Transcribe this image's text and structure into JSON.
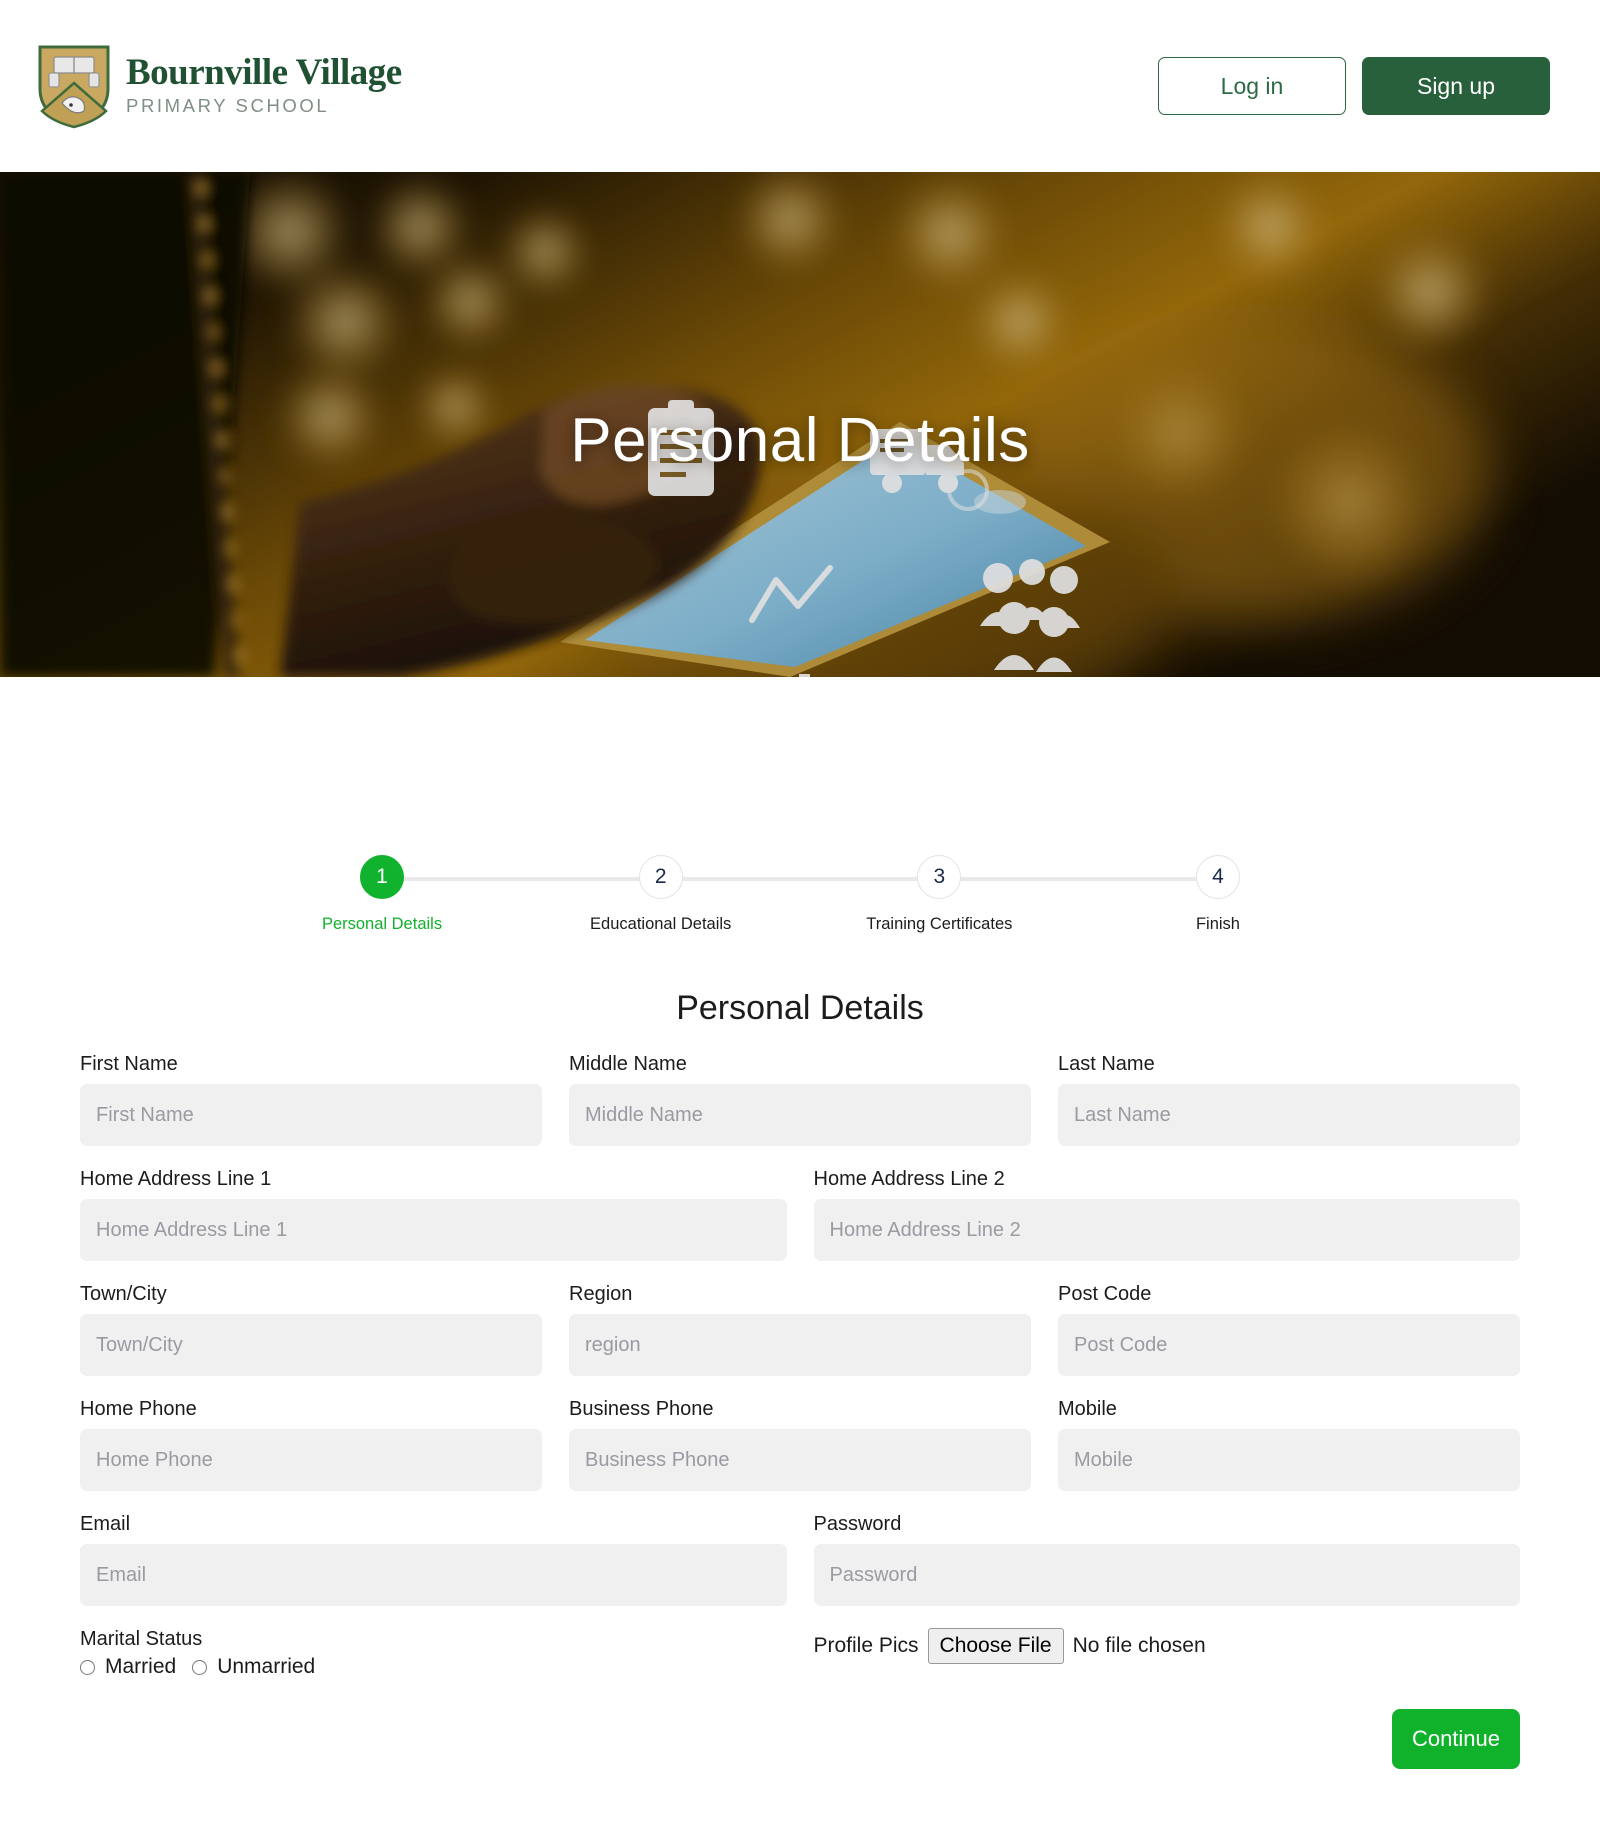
{
  "header": {
    "logo": {
      "name": "Bournville Village",
      "subtitle": "PRIMARY SCHOOL",
      "crest_icon": "school-crest-icon"
    },
    "login_label": "Log in",
    "signup_label": "Sign up"
  },
  "hero": {
    "title": "Personal Details"
  },
  "stepper": {
    "steps": [
      {
        "number": "1",
        "label": "Personal Details",
        "active": true
      },
      {
        "number": "2",
        "label": "Educational Details",
        "active": false
      },
      {
        "number": "3",
        "label": "Training Certificates",
        "active": false
      },
      {
        "number": "4",
        "label": "Finish",
        "active": false
      }
    ]
  },
  "form": {
    "heading": "Personal Details",
    "first_name": {
      "label": "First Name",
      "placeholder": "First Name",
      "value": ""
    },
    "middle_name": {
      "label": "Middle Name",
      "placeholder": "Middle Name",
      "value": ""
    },
    "last_name": {
      "label": "Last Name",
      "placeholder": "Last Name",
      "value": ""
    },
    "address1": {
      "label": "Home Address Line 1",
      "placeholder": "Home Address Line 1",
      "value": ""
    },
    "address2": {
      "label": "Home Address Line 2",
      "placeholder": "Home Address Line 2",
      "value": ""
    },
    "town_city": {
      "label": "Town/City",
      "placeholder": "Town/City",
      "value": ""
    },
    "region": {
      "label": "Region",
      "placeholder": "region",
      "value": ""
    },
    "post_code": {
      "label": "Post Code",
      "placeholder": "Post Code",
      "value": ""
    },
    "home_phone": {
      "label": "Home Phone",
      "placeholder": "Home Phone",
      "value": ""
    },
    "business_phone": {
      "label": "Business Phone",
      "placeholder": "Business Phone",
      "value": ""
    },
    "mobile": {
      "label": "Mobile",
      "placeholder": "Mobile",
      "value": ""
    },
    "email": {
      "label": "Email",
      "placeholder": "Email",
      "value": ""
    },
    "password": {
      "label": "Password",
      "placeholder": "Password",
      "value": ""
    },
    "marital_status": {
      "label": "Marital Status",
      "options": [
        {
          "label": "Married",
          "selected": false
        },
        {
          "label": "Unmarried",
          "selected": false
        }
      ]
    },
    "profile_pics": {
      "label": "Profile Pics",
      "button_label": "Choose File",
      "status": "No file chosen"
    },
    "continue_label": "Continue"
  },
  "colors": {
    "brand_green_dark": "#28603c",
    "brand_green_text": "#1f5132",
    "accent_green": "#11b22e",
    "input_bg": "#f0f0f0",
    "track_gray": "#e9e9ec"
  }
}
